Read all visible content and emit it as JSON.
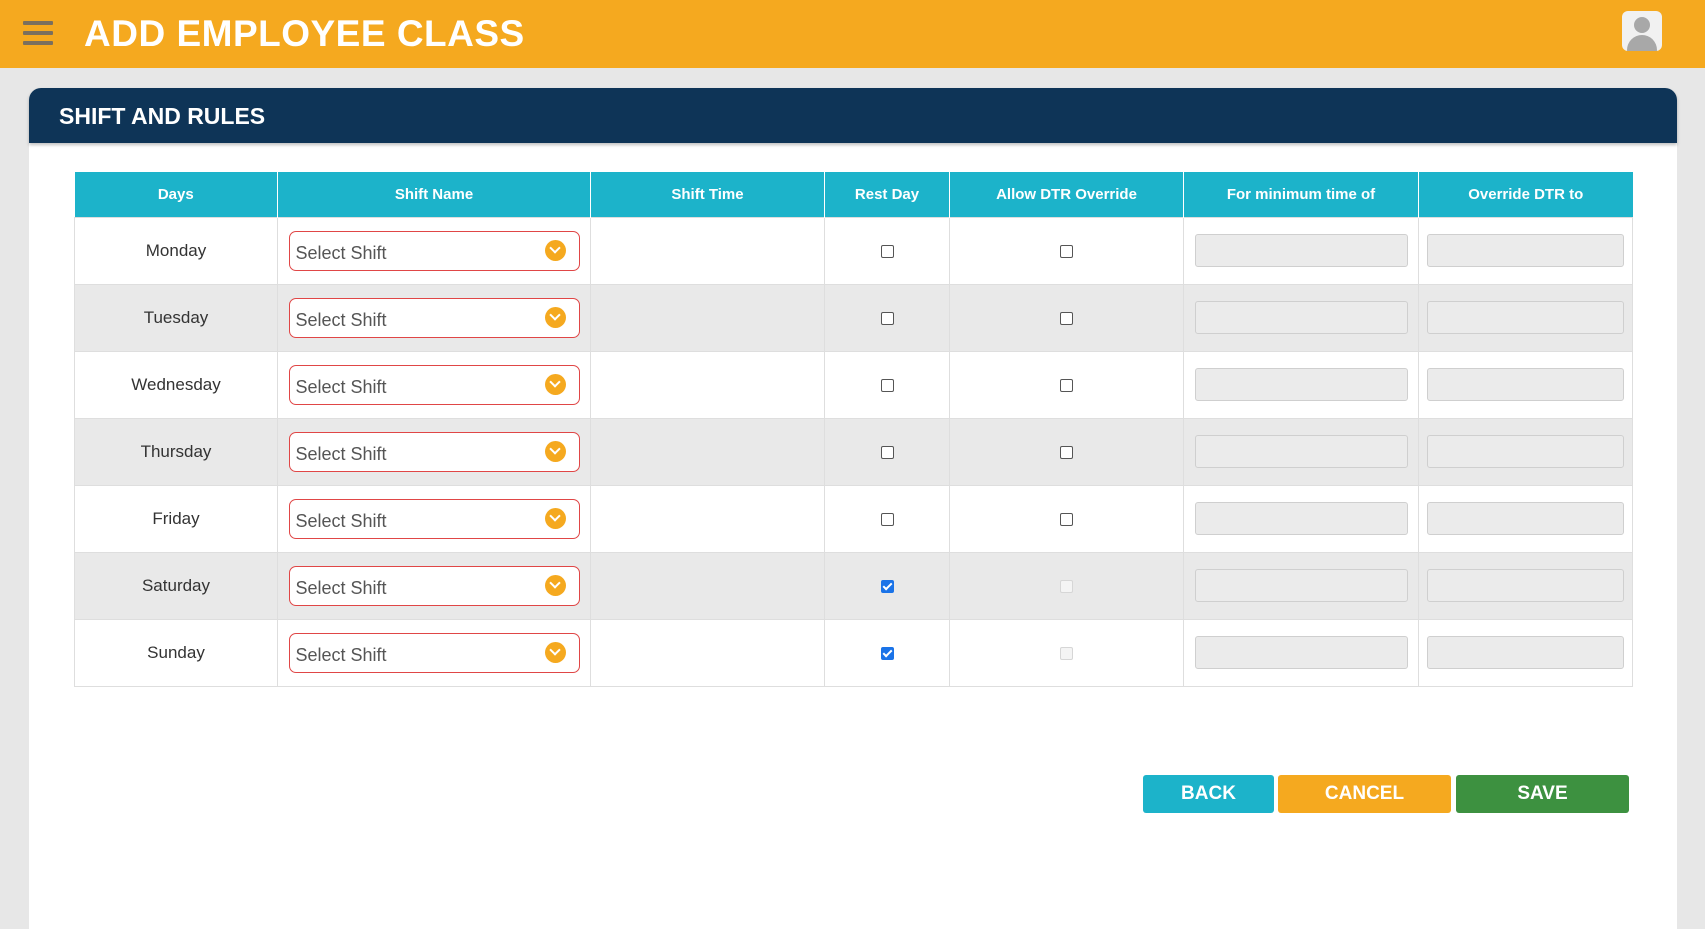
{
  "header": {
    "title": "ADD EMPLOYEE CLASS",
    "menu_icon": "hamburger-menu-icon",
    "avatar_icon": "user-avatar-icon"
  },
  "section": {
    "title": "SHIFT AND RULES"
  },
  "table": {
    "columns": [
      "Days",
      "Shift Name",
      "Shift Time",
      "Rest Day",
      "Allow DTR Override",
      "For minimum time of",
      "Override DTR to"
    ],
    "rows": [
      {
        "day": "Monday",
        "shift": "Select Shift",
        "shift_time": "",
        "rest_day": false,
        "allow_override": false,
        "override_disabled": false,
        "min_time": "",
        "override_to": ""
      },
      {
        "day": "Tuesday",
        "shift": "Select Shift",
        "shift_time": "",
        "rest_day": false,
        "allow_override": false,
        "override_disabled": false,
        "min_time": "",
        "override_to": ""
      },
      {
        "day": "Wednesday",
        "shift": "Select Shift",
        "shift_time": "",
        "rest_day": false,
        "allow_override": false,
        "override_disabled": false,
        "min_time": "",
        "override_to": ""
      },
      {
        "day": "Thursday",
        "shift": "Select Shift",
        "shift_time": "",
        "rest_day": false,
        "allow_override": false,
        "override_disabled": false,
        "min_time": "",
        "override_to": ""
      },
      {
        "day": "Friday",
        "shift": "Select Shift",
        "shift_time": "",
        "rest_day": false,
        "allow_override": false,
        "override_disabled": false,
        "min_time": "",
        "override_to": ""
      },
      {
        "day": "Saturday",
        "shift": "Select Shift",
        "shift_time": "",
        "rest_day": true,
        "allow_override": false,
        "override_disabled": true,
        "min_time": "",
        "override_to": ""
      },
      {
        "day": "Sunday",
        "shift": "Select Shift",
        "shift_time": "",
        "rest_day": true,
        "allow_override": false,
        "override_disabled": true,
        "min_time": "",
        "override_to": ""
      }
    ]
  },
  "buttons": {
    "back": "BACK",
    "cancel": "CANCEL",
    "save": "SAVE"
  },
  "colors": {
    "topbar": "#f5a91f",
    "section_header": "#0e3457",
    "table_header": "#1cb3ca",
    "back": "#1cb3ca",
    "cancel": "#f5a91f",
    "save": "#3d9140",
    "select_border": "#e04646"
  }
}
